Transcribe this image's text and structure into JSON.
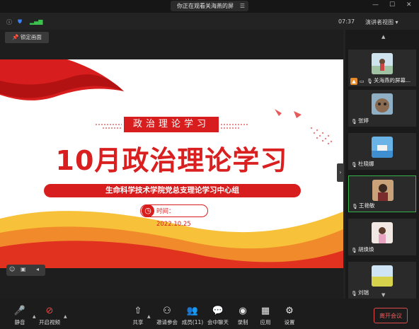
{
  "window": {
    "sharing_title": "你正在观看关海燕的屏幕",
    "clock": "07:37",
    "view_mode": "演讲者视图 ▾",
    "lock_screen_label": "锁定画面"
  },
  "slide": {
    "subtitle": "政治理论学习",
    "title": "10月政治理论学习",
    "organization": "生命科学技术学院党总支理论学习中心组",
    "time_label": "时间：2022.10.25"
  },
  "participants": [
    {
      "name": "关海燕的屏幕...",
      "active": false,
      "presenting": true
    },
    {
      "name": "张婷",
      "active": false
    },
    {
      "name": "杜晓娜",
      "active": false
    },
    {
      "name": "王艳敏",
      "active": true
    },
    {
      "name": "胡焕焕",
      "active": false
    },
    {
      "name": "刘瑞",
      "active": false
    }
  ],
  "toolbar": {
    "mute": "静音",
    "video": "开启视频",
    "share": "共享",
    "invite": "邀请参会",
    "members": "成员(11)",
    "chat": "会中聊天",
    "record": "录制",
    "apps": "应用",
    "settings": "设置",
    "leave": "离开会议"
  },
  "colors": {
    "accent_red": "#d71d1d",
    "active_green": "#35b24a",
    "leave_red": "#e04a4a"
  }
}
